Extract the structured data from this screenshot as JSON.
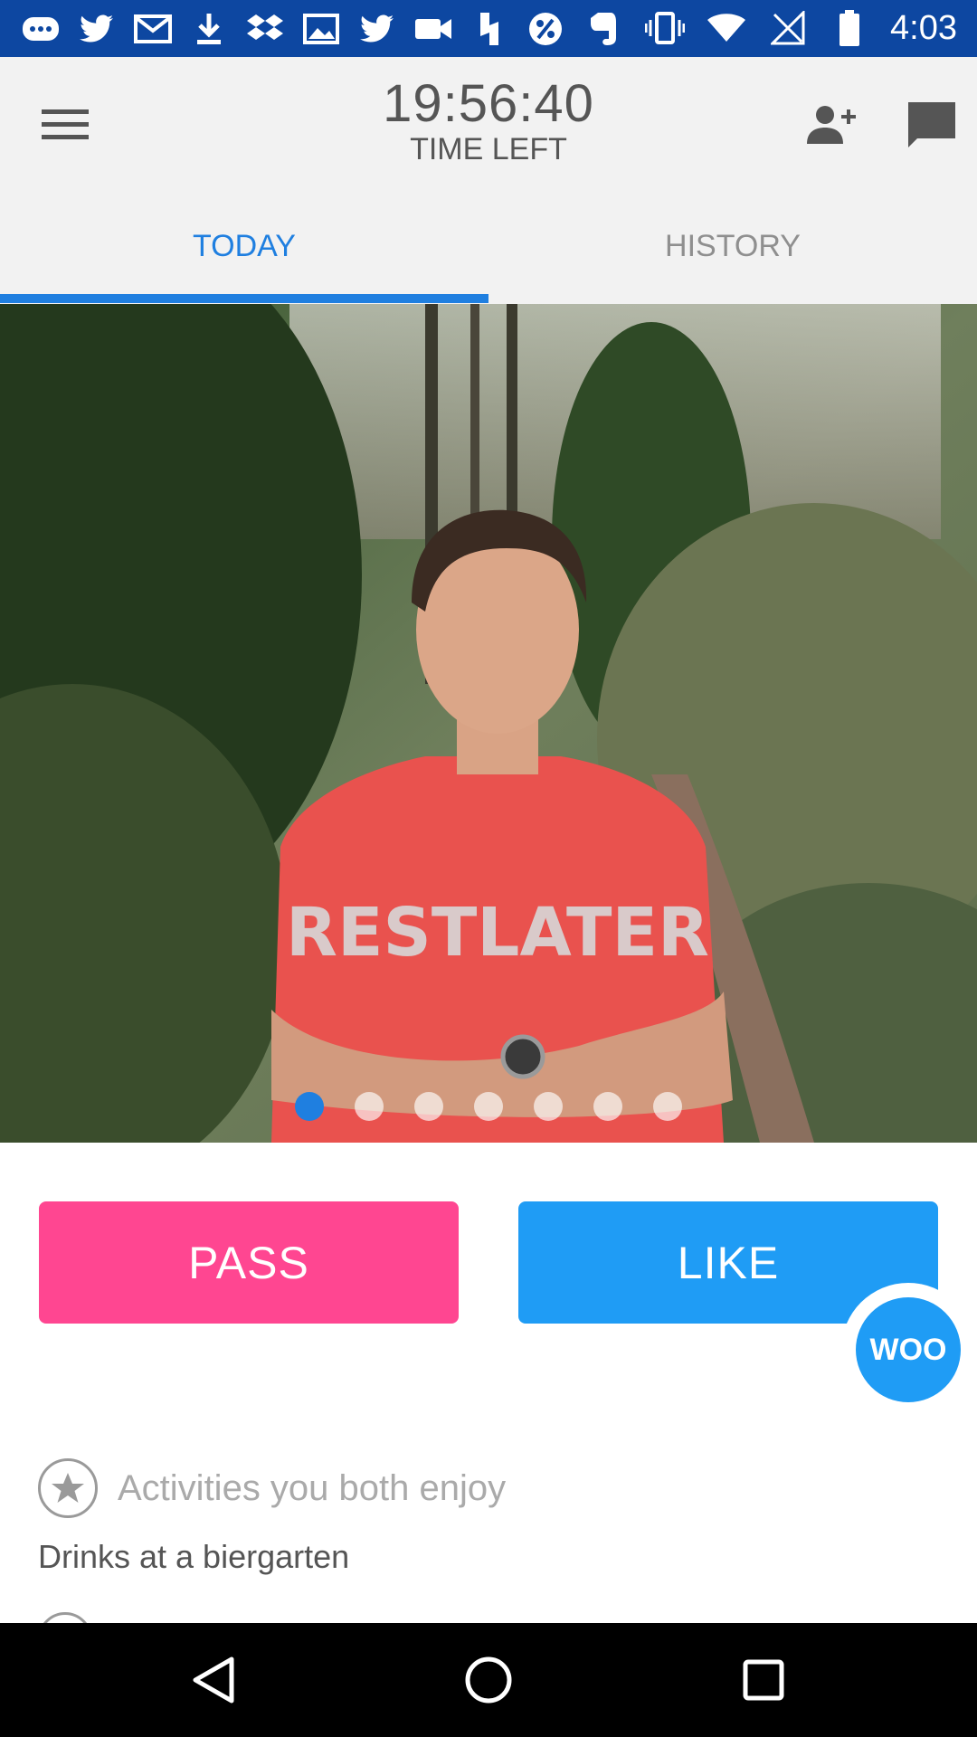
{
  "status_bar": {
    "time": "4:03",
    "left_icons": [
      "chat-bubble-icon",
      "twitter-icon",
      "gmail-icon",
      "download-icon",
      "dropbox-icon",
      "image-icon",
      "twitter-icon",
      "video-camera-icon",
      "bolt-icon",
      "percent-icon",
      "evernote-icon"
    ],
    "right_icons": [
      "vibrate-icon",
      "wifi-icon",
      "no-signal-icon",
      "battery-icon"
    ]
  },
  "toolbar": {
    "timer_value": "19:56:40",
    "timer_label": "TIME LEFT"
  },
  "tabs": [
    {
      "label": "TODAY",
      "active": true
    },
    {
      "label": "HISTORY",
      "active": false
    }
  ],
  "photo": {
    "shirt_text": "RESTLATER",
    "dot_count": 7,
    "active_dot": 0
  },
  "actions": {
    "pass_label": "PASS",
    "like_label": "LIKE",
    "woo_label": "WOO"
  },
  "activities": {
    "title": "Activities you both enjoy",
    "items": [
      "Drinks at a biergarten"
    ]
  },
  "colors": {
    "status_bar": "#0d47a1",
    "accent": "#1f7fe0",
    "pass": "#ff4691",
    "like": "#1f9cf5"
  }
}
